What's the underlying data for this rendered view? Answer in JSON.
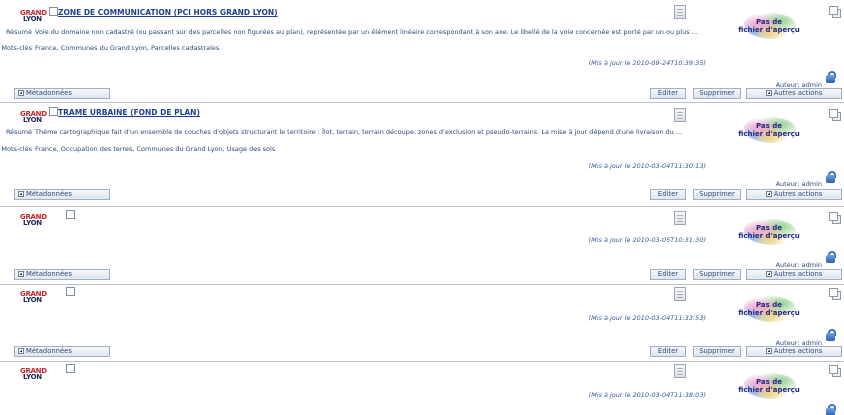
{
  "logo": {
    "line1": "GRAND",
    "line2": "LYON"
  },
  "labels": {
    "resume": "Résumé",
    "keywords": "Mots-clés"
  },
  "preview_text": {
    "line1": "Pas de",
    "line2": "fichier d'aperçu"
  },
  "actions": {
    "metadata": "Métadonnées",
    "edit": "Editer",
    "delete": "Supprimer",
    "more": "Autres actions"
  },
  "author_label": "Auteur: admin",
  "records": [
    {
      "title": "ZONE DE COMMUNICATION (PCI HORS GRAND LYON)",
      "summary": "Voie du domaine non cadastré (ou passant sur des parcelles non figurées au plan), représentée par un élément linéaire correspondant à son axe. Le libellé de la voie concernée est porté par un ou plus ...",
      "keywords": "France, Communes du Grand Lyon, Parcelles cadastrales",
      "updated": "(Mis à jour le 2010-09-24T10:39:35)"
    },
    {
      "title": "TRAME URBAINE (FOND DE PLAN)",
      "summary": "Thème cartographique fait d'un ensemble de couches d'objets structurant le territoire : Îlot, terrain, terrain découpe, zones d'exclusion et pseudo-terrains. La mise à jour dépend d'une livraison du ...",
      "keywords": "France, Occupation des terres, Communes du Grand Lyon, Usage des sols",
      "updated": "(Mis à jour le 2010-03-04T11:30:13)"
    },
    {
      "title": "",
      "summary": "",
      "keywords": "",
      "updated": "(Mis à jour le 2010-03-05T10:31:30)"
    },
    {
      "title": "",
      "summary": "",
      "keywords": "",
      "updated": "(Mis à jour le 2010-03-04T11:33:53)"
    },
    {
      "title": "",
      "summary": "",
      "keywords": "",
      "updated": "(Mis à jour le 2010-03-04T11:38:03)"
    }
  ]
}
